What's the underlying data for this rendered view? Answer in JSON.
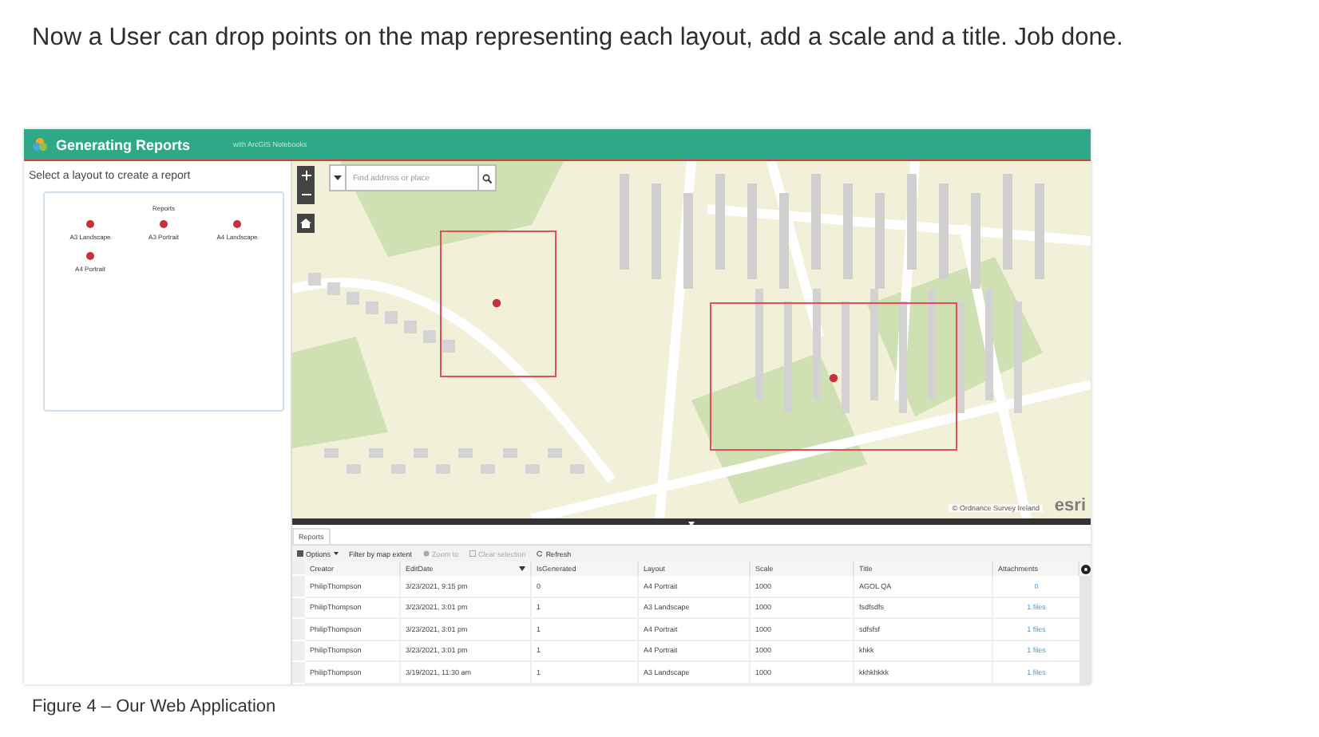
{
  "intro": "Now a User can drop points on the map representing each layout, add a scale and a title. Job done.",
  "app": {
    "title": "Generating Reports",
    "subtitle": "with ArcGIS Notebooks"
  },
  "panel": {
    "instruction": "Select a layout to create a report",
    "card_title": "Reports",
    "layouts": [
      {
        "label": "A3 Landscape"
      },
      {
        "label": "A3 Portrait"
      },
      {
        "label": "A4 Landscape"
      },
      {
        "label": "A4 Portrait"
      }
    ]
  },
  "map": {
    "search": {
      "placeholder": "Find address or place"
    },
    "attribution": "© Ordnance Survey Ireland",
    "logo": "esri"
  },
  "table": {
    "tab": "Reports",
    "toolbar": [
      {
        "kind": "menu",
        "label": "Options",
        "disabled": false
      },
      {
        "kind": "text",
        "label": "Filter by map extent",
        "disabled": false
      },
      {
        "kind": "zoom",
        "label": "Zoom to",
        "disabled": true
      },
      {
        "kind": "clear",
        "label": "Clear selection",
        "disabled": true
      },
      {
        "kind": "refresh",
        "label": "Refresh",
        "disabled": false
      }
    ],
    "columns": [
      {
        "label": "Creator",
        "sorted": false
      },
      {
        "label": "EditDate",
        "sorted": true
      },
      {
        "label": "IsGenerated",
        "sorted": false
      },
      {
        "label": "Layout",
        "sorted": false
      },
      {
        "label": "Scale",
        "sorted": false
      },
      {
        "label": "Title",
        "sorted": false
      },
      {
        "label": "Attachments",
        "sorted": false
      }
    ],
    "rows": [
      [
        "PhilipThompson",
        "3/23/2021, 9:15 pm",
        "0",
        "A4 Portrait",
        "1000",
        "AGOL QA",
        "0"
      ],
      [
        "PhilipThompson",
        "3/23/2021, 3:01 pm",
        "1",
        "A3 Landscape",
        "1000",
        "fsdfsdfs",
        "1 files"
      ],
      [
        "PhilipThompson",
        "3/23/2021, 3:01 pm",
        "1",
        "A4 Portrait",
        "1000",
        "sdfsfsf",
        "1 files"
      ],
      [
        "PhilipThompson",
        "3/23/2021, 3:01 pm",
        "1",
        "A4 Portrait",
        "1000",
        "khkk",
        "1 files"
      ],
      [
        "PhilipThompson",
        "3/19/2021, 11:30 am",
        "1",
        "A3 Landscape",
        "1000",
        "kkhkhkkk",
        "1 files"
      ]
    ]
  },
  "caption": "Figure 4 – Our Web Application"
}
